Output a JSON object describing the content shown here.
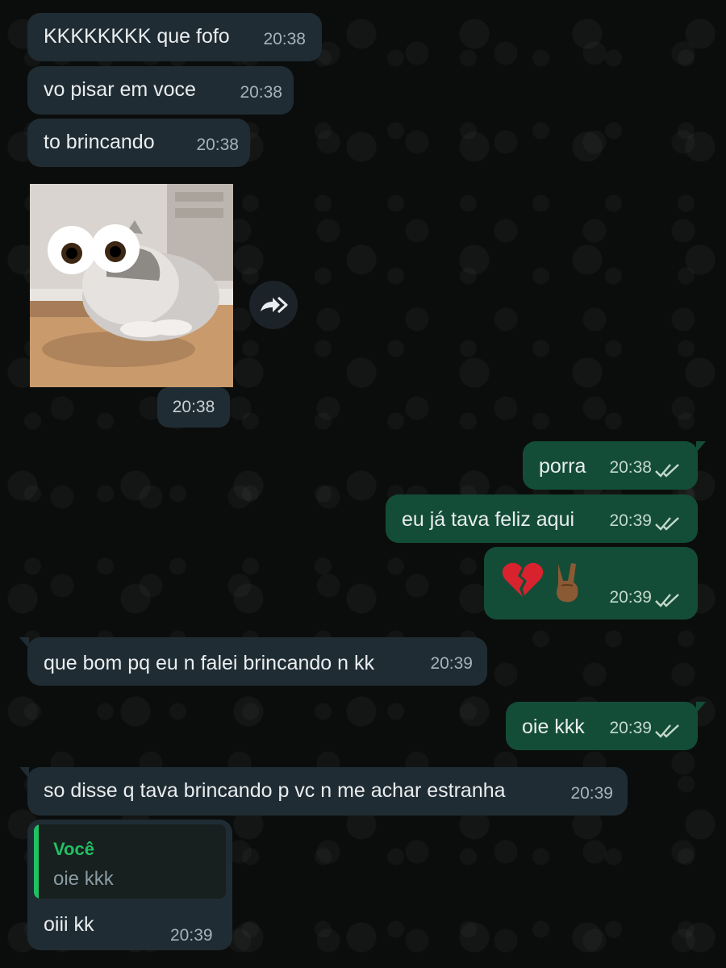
{
  "messages": [
    {
      "text": "KKKKKKKK que fofo",
      "time": "20:38"
    },
    {
      "text": "vo pisar em voce",
      "time": "20:38"
    },
    {
      "text": "to brincando",
      "time": "20:38"
    },
    {
      "media_time": "20:38"
    },
    {
      "text": "porra",
      "time": "20:38"
    },
    {
      "text": "eu já tava feliz aqui",
      "time": "20:39"
    },
    {
      "emoji": [
        "broken-heart-icon",
        "victory-hand-icon"
      ],
      "time": "20:39"
    },
    {
      "text": "que bom pq eu n falei brincando n kk",
      "time": "20:39"
    },
    {
      "text": "oie kkk",
      "time": "20:39"
    },
    {
      "text": "so disse q tava brincando p vc n me achar estranha",
      "time": "20:39"
    },
    {
      "quote_author": "Você",
      "quote_text": "oie kkk",
      "text": "oiii kk",
      "time": "20:39"
    }
  ],
  "colors": {
    "background": "#0b0d0c",
    "incoming_bubble": "#202c33",
    "outgoing_bubble": "#144d37",
    "quote_accent": "#21c063"
  }
}
